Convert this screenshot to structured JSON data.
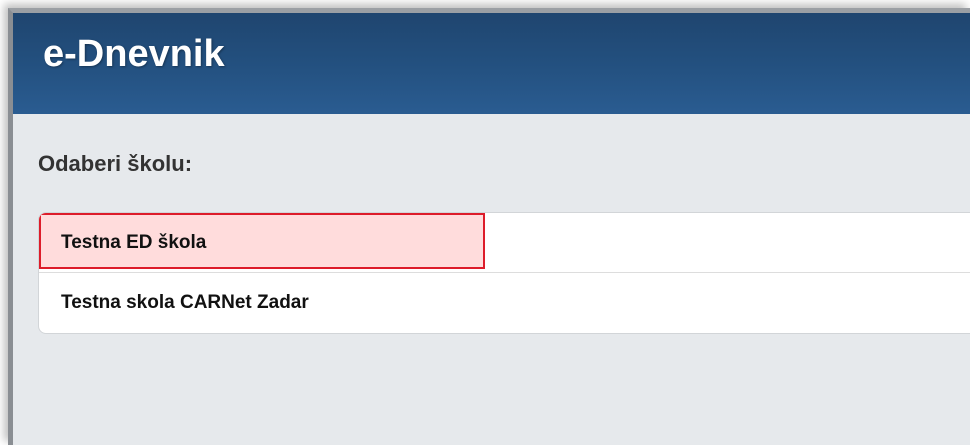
{
  "header": {
    "app_title": "e-Dnevnik"
  },
  "main": {
    "heading": "Odaberi školu:",
    "schools": [
      {
        "label": "Testna ED škola",
        "highlighted": true
      },
      {
        "label": "Testna skola CARNet Zadar",
        "highlighted": false
      }
    ]
  },
  "colors": {
    "header_bg": "#23507f",
    "page_bg": "#e6e9ec",
    "highlight_bg": "#ffdcdc",
    "highlight_border": "#dd1c2a"
  }
}
